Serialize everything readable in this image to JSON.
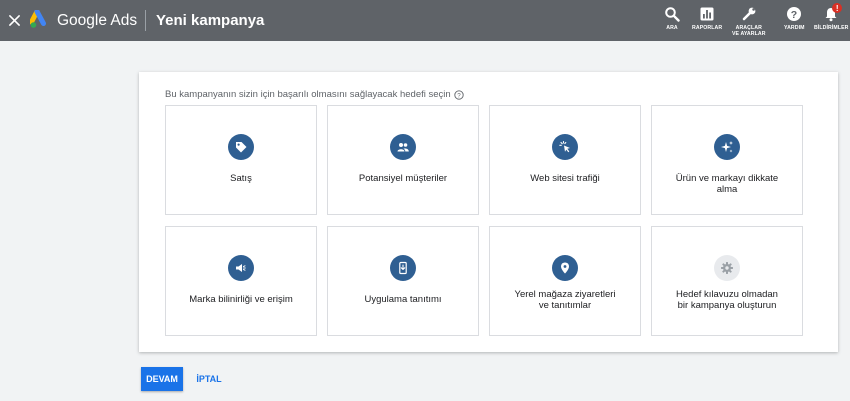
{
  "header": {
    "brand": "Google Ads",
    "title": "Yeni kampanya",
    "close_icon": "close-icon",
    "tools": [
      {
        "icon": "search-icon",
        "label": "ARA"
      },
      {
        "icon": "reports-icon",
        "label": "RAPORLAR"
      },
      {
        "icon": "wrench-icon",
        "label": "ARAÇLAR\nVE AYARLAR"
      },
      {
        "icon": "help-icon",
        "label": "YARDIM"
      },
      {
        "icon": "bell-icon",
        "label": "BİLDİRİMLER",
        "badge": "!"
      }
    ]
  },
  "goal_selector": {
    "prompt": "Bu kampanyanın sizin için başarılı olmasını sağlayacak hedefi seçin",
    "goals": [
      {
        "label": "Satış",
        "icon": "tag-icon"
      },
      {
        "label": "Potansiyel müşteriler",
        "icon": "people-icon"
      },
      {
        "label": "Web sitesi trafiği",
        "icon": "cursor-click-icon"
      },
      {
        "label": "Ürün ve markayı dikkate alma",
        "icon": "sparkle-icon"
      },
      {
        "label": "Marka bilinirliği ve erişim",
        "icon": "megaphone-icon"
      },
      {
        "label": "Uygulama tanıtımı",
        "icon": "phone-download-icon"
      },
      {
        "label": "Yerel mağaza ziyaretleri ve tanıtımlar",
        "icon": "location-pin-icon"
      },
      {
        "label": "Hedef kılavuzu olmadan bir kampanya oluşturun",
        "icon": "gear-icon"
      }
    ]
  },
  "actions": {
    "continue": "DEVAM",
    "cancel": "İPTAL"
  },
  "colors": {
    "topbar": "#5f6368",
    "accent": "#1a73e8",
    "goal_icon_bg": "#2f5f92",
    "background": "#f1f3f4"
  }
}
